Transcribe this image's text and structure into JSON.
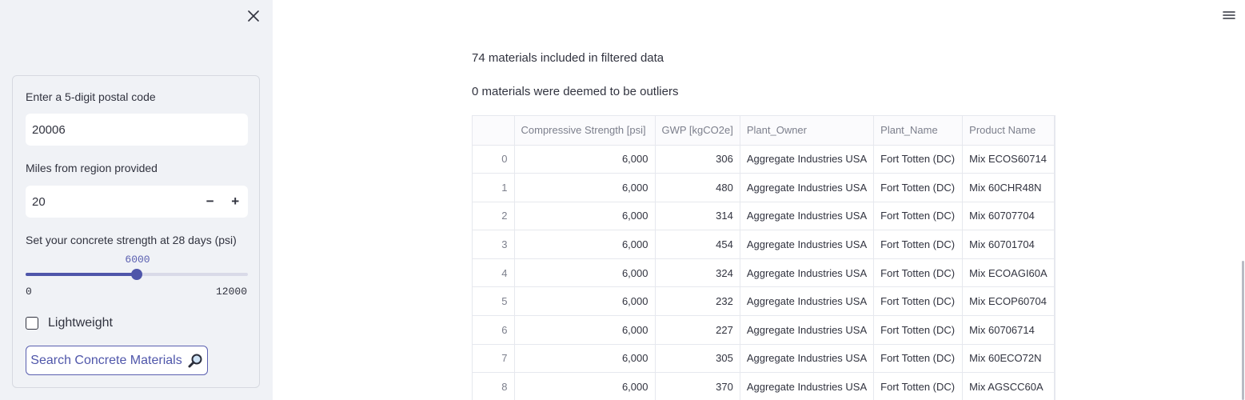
{
  "sidebar": {
    "postal_label": "Enter a 5-digit postal code",
    "postal_value": "20006",
    "miles_label": "Miles from region provided",
    "miles_value": "20",
    "minus_label": "−",
    "plus_label": "+",
    "strength_label": "Set your concrete strength at 28 days (psi)",
    "strength_value": "6000",
    "strength_fraction": 0.5,
    "strength_min": "0",
    "strength_max": "12000",
    "lightweight_label": "Lightweight",
    "lightweight_checked": false,
    "search_button_label": "Search Concrete Materials",
    "search_button_icon": "magnifier-icon"
  },
  "main": {
    "included_text": "74 materials included in filtered data",
    "outliers_text": "0 materials were deemed to be outliers",
    "table": {
      "columns": [
        "",
        "Compressive Strength [psi]",
        "GWP [kgCO2e]",
        "Plant_Owner",
        "Plant_Name",
        "Product Name"
      ],
      "rows": [
        [
          "0",
          "6,000",
          "306",
          "Aggregate Industries USA",
          "Fort Totten (DC)",
          "Mix ECOS60714"
        ],
        [
          "1",
          "6,000",
          "480",
          "Aggregate Industries USA",
          "Fort Totten (DC)",
          "Mix 60CHR48N"
        ],
        [
          "2",
          "6,000",
          "314",
          "Aggregate Industries USA",
          "Fort Totten (DC)",
          "Mix 60707704"
        ],
        [
          "3",
          "6,000",
          "454",
          "Aggregate Industries USA",
          "Fort Totten (DC)",
          "Mix 60701704"
        ],
        [
          "4",
          "6,000",
          "324",
          "Aggregate Industries USA",
          "Fort Totten (DC)",
          "Mix ECOAGI60A"
        ],
        [
          "5",
          "6,000",
          "232",
          "Aggregate Industries USA",
          "Fort Totten (DC)",
          "Mix ECOP60704"
        ],
        [
          "6",
          "6,000",
          "227",
          "Aggregate Industries USA",
          "Fort Totten (DC)",
          "Mix 60706714"
        ],
        [
          "7",
          "6,000",
          "305",
          "Aggregate Industries USA",
          "Fort Totten (DC)",
          "Mix 60ECO72N"
        ],
        [
          "8",
          "6,000",
          "370",
          "Aggregate Industries USA",
          "Fort Totten (DC)",
          "Mix AGSCC60A"
        ]
      ]
    }
  },
  "icons": {
    "close": "close-icon",
    "menu": "hamburger-menu-icon"
  },
  "colors": {
    "accent": "#4f56aa",
    "sidebar_bg": "#f0f2f6"
  }
}
